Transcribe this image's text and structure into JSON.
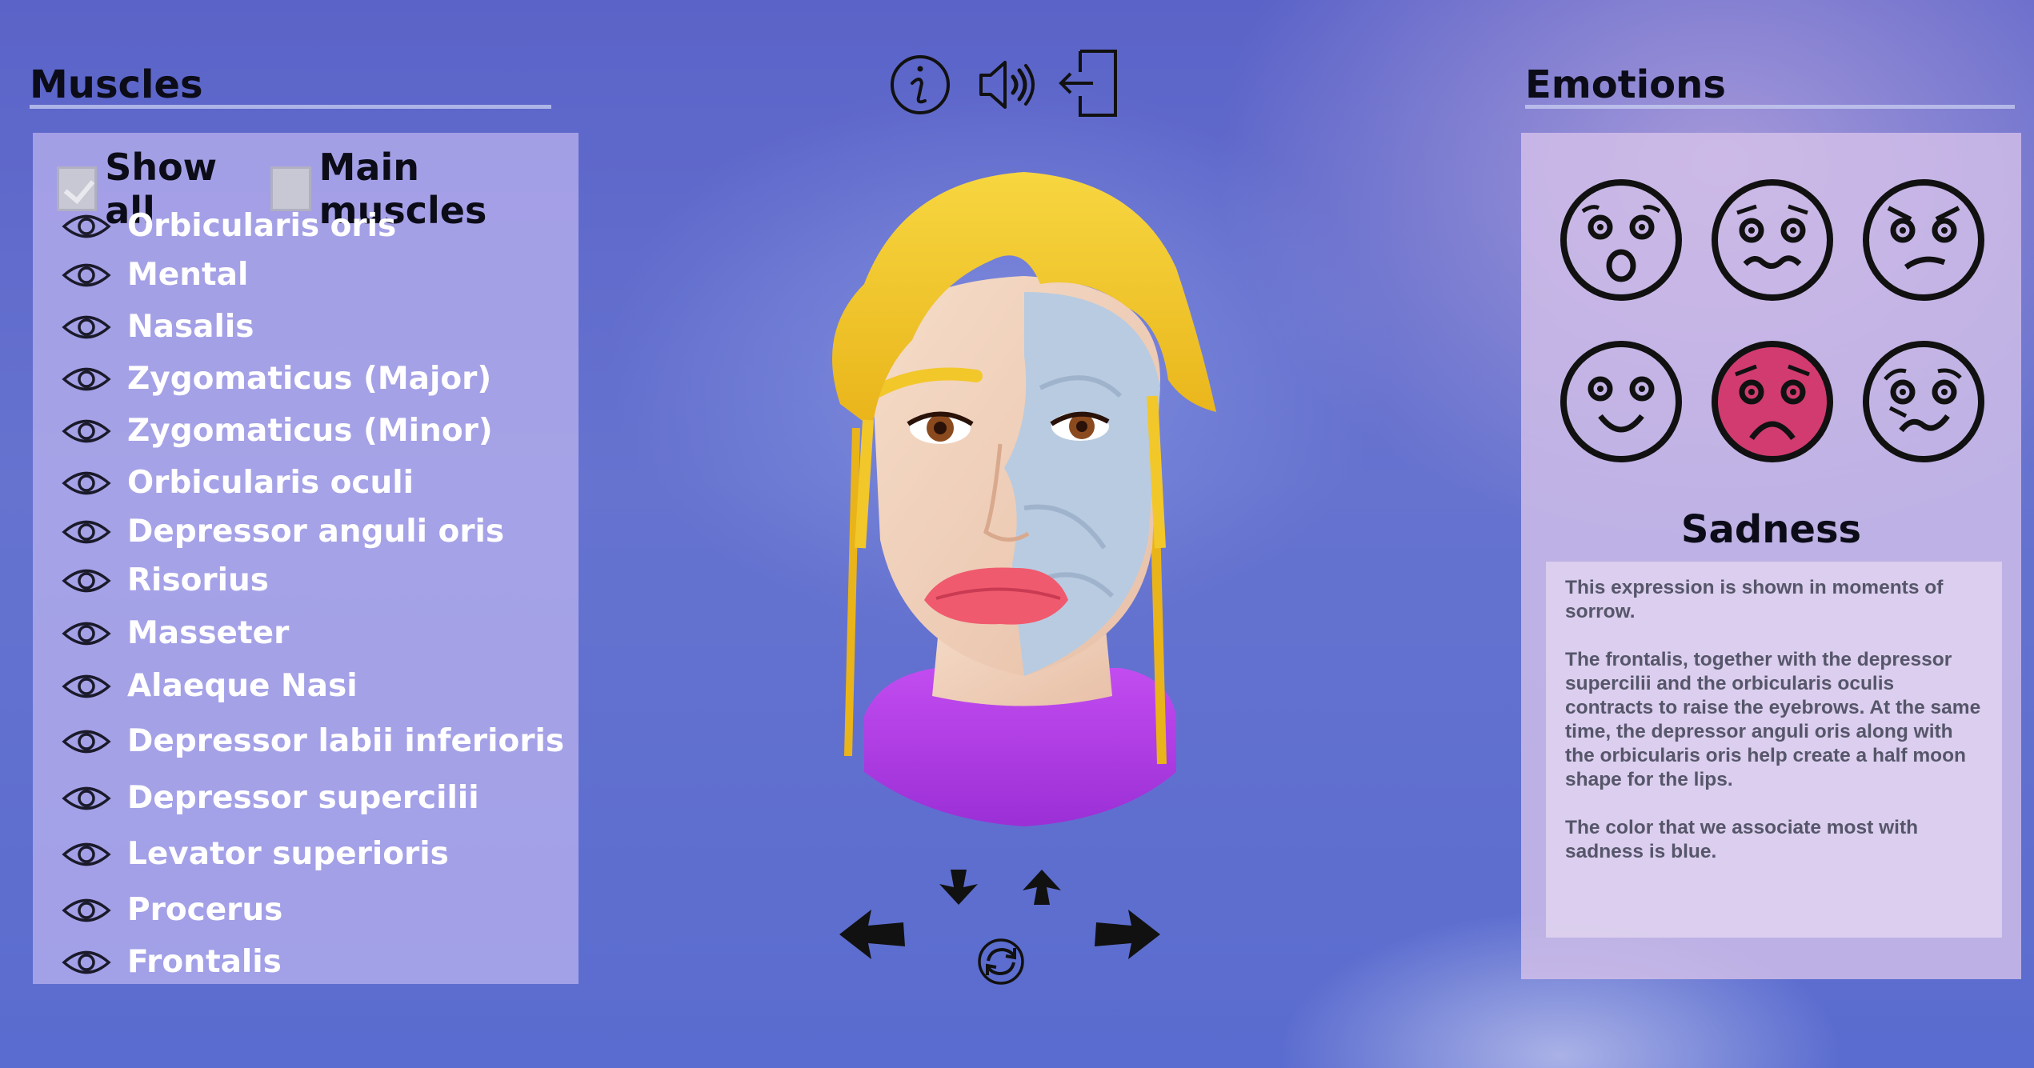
{
  "muscles": {
    "title": "Muscles",
    "show_all": {
      "label": "Show all",
      "checked": true
    },
    "main_muscles": {
      "label": "Main muscles",
      "checked": false
    },
    "items": [
      "Orbicularis oris",
      "Mental",
      "Nasalis",
      "Zygomaticus (Major)",
      "Zygomaticus (Minor)",
      "Orbicularis oculi",
      "Depressor anguli oris",
      "Risorius",
      "Masseter",
      "Alaeque Nasi",
      "Depressor labii inferioris",
      "Depressor supercilii",
      "Levator superioris",
      "Procerus",
      "Frontalis"
    ]
  },
  "toolbar": {
    "icons": [
      "info-icon",
      "speaker-icon",
      "exit-icon"
    ]
  },
  "navigation": {
    "icons": [
      "arrow-left-icon",
      "arrow-down-icon",
      "arrow-up-icon",
      "arrow-right-icon",
      "reset-rotation-icon"
    ]
  },
  "emotions": {
    "title": "Emotions",
    "faces": [
      "surprise",
      "fear",
      "anger",
      "happiness",
      "sadness",
      "disgust"
    ],
    "selected": "sadness",
    "selected_color": "#d23b70",
    "selected_name": "Sadness",
    "description": "This expression is shown in moments of sorrow.\n\nThe frontalis, together with the depressor supercilii and the orbicularis oculis contracts to raise the eyebrows. At the same time, the depressor anguli oris along with the orbicularis oris help create a half moon shape for the lips.\n\nThe color that we associate most with sadness is blue."
  },
  "colors": {
    "panel_text": "#ffffff",
    "title_text": "#0c0c18",
    "hair": "#f2c72a",
    "shirt": "#b23ee8",
    "lips": "#f05a6e",
    "muscle": "#b9cbe0"
  }
}
